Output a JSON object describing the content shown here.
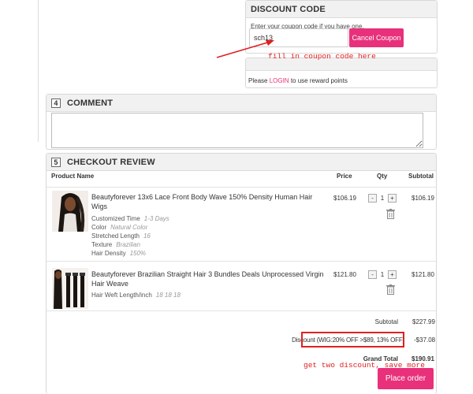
{
  "discount": {
    "title": "DISCOUNT CODE",
    "hint": "Enter your coupon code if you have one.",
    "coupon_value": "sch13",
    "cancel_label": "Cancel Coupon"
  },
  "reward": {
    "text_before": "Please ",
    "login_label": "LOGIN",
    "text_after": " to use reward points"
  },
  "comment": {
    "number": "4",
    "title": "COMMENT"
  },
  "review": {
    "number": "5",
    "title": "CHECKOUT REVIEW",
    "columns": {
      "product": "Product Name",
      "price": "Price",
      "qty": "Qty",
      "subtotal": "Subtotal"
    },
    "items": [
      {
        "name": "Beautyforever 13x6 Lace Front Body Wave 150% Density Human Hair Wigs",
        "options": [
          {
            "label": "Customized Time",
            "value": "1-3 Days"
          },
          {
            "label": "Color",
            "value": "Natural Color"
          },
          {
            "label": "Stretched Length",
            "value": "16"
          },
          {
            "label": "Texture",
            "value": "Brazilian"
          },
          {
            "label": "Hair Density",
            "value": "150%"
          }
        ],
        "price": "$106.19",
        "qty": "1",
        "subtotal": "$106.19"
      },
      {
        "name": "Beautyforever Brazilian Straight Hair 3 Bundles Deals Unprocessed Virgin Hair Weave",
        "options": [
          {
            "label": "Hair Weft Length/inch",
            "value": "18 18 18"
          }
        ],
        "price": "$121.80",
        "qty": "1",
        "subtotal": "$121.80"
      }
    ],
    "qty_minus": "-",
    "qty_plus": "+",
    "totals": {
      "subtotal_label": "Subtotal",
      "subtotal_value": "$227.99",
      "discount_label": "Discount (WIG:20% OFF >$89, 13% OFF)",
      "discount_value": "-$37.08",
      "grand_label": "Grand Total",
      "grand_value": "$190.91"
    },
    "place_order_label": "Place order"
  },
  "annotations": {
    "coupon_note": "fill in coupon code here",
    "discount_note": "get two discount, save more"
  },
  "colors": {
    "accent_pink": "#e8317a",
    "annotation_red": "#e02020"
  }
}
